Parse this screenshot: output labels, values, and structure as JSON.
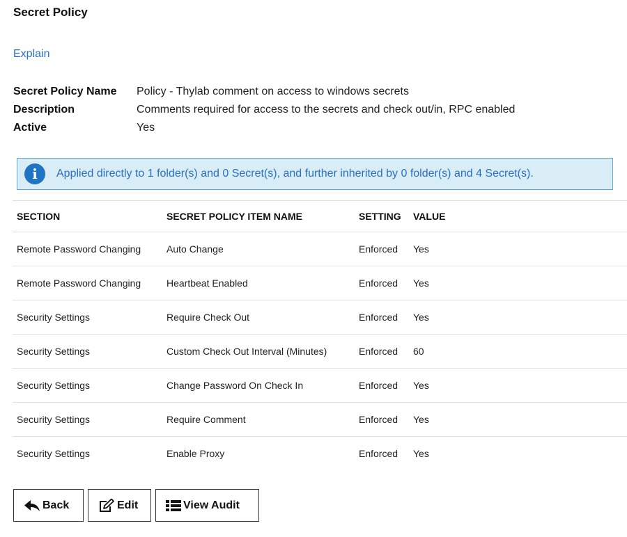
{
  "header": {
    "title": "Secret Policy",
    "explain_link": "Explain"
  },
  "properties": [
    {
      "label": "Secret Policy Name",
      "value": "Policy - Thylab comment on access to windows secrets"
    },
    {
      "label": "Description",
      "value": "Comments required for access to the secrets and check out/in, RPC enabled"
    },
    {
      "label": "Active",
      "value": "Yes"
    }
  ],
  "info_banner": {
    "icon": "info-icon",
    "text": "Applied directly to 1 folder(s) and 0 Secret(s), and further inherited by 0 folder(s) and 4 Secret(s)."
  },
  "table": {
    "columns": [
      "SECTION",
      "SECRET POLICY ITEM NAME",
      "SETTING",
      "VALUE"
    ],
    "rows": [
      [
        "Remote Password Changing",
        "Auto Change",
        "Enforced",
        "Yes"
      ],
      [
        "Remote Password Changing",
        "Heartbeat Enabled",
        "Enforced",
        "Yes"
      ],
      [
        "Security Settings",
        "Require Check Out",
        "Enforced",
        "Yes"
      ],
      [
        "Security Settings",
        "Custom Check Out Interval (Minutes)",
        "Enforced",
        "60"
      ],
      [
        "Security Settings",
        "Change Password On Check In",
        "Enforced",
        "Yes"
      ],
      [
        "Security Settings",
        "Require Comment",
        "Enforced",
        "Yes"
      ],
      [
        "Security Settings",
        "Enable Proxy",
        "Enforced",
        "Yes"
      ]
    ]
  },
  "actions": {
    "back_label": "Back",
    "edit_label": "Edit",
    "audit_label": "View Audit"
  },
  "colors": {
    "link": "#2a6fc4",
    "info_bg": "#d9edf7",
    "info_border": "#5aa8dc",
    "info_icon": "#1f74c4"
  }
}
